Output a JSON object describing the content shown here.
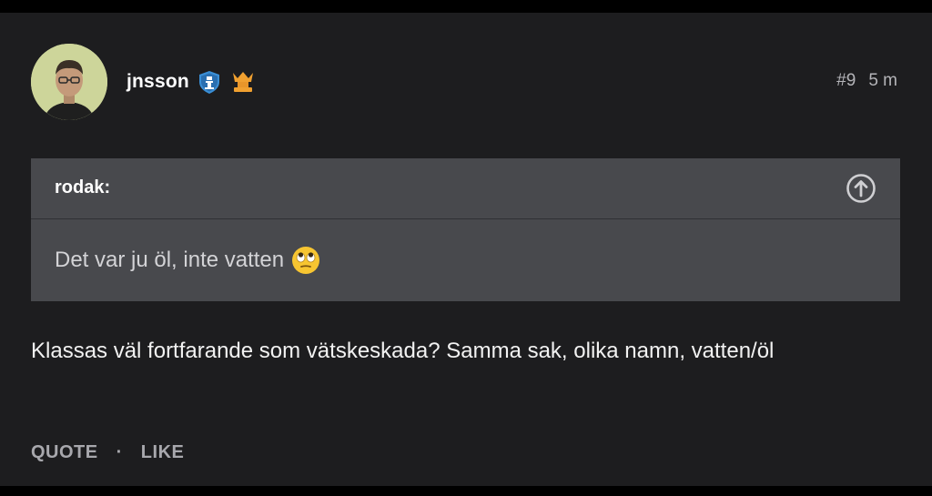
{
  "post": {
    "author": "jnsson",
    "badges": [
      "shield-badge-icon",
      "crown-badge-icon"
    ],
    "number": "#9",
    "time": "5 m"
  },
  "quote": {
    "author": "rodak:",
    "text": "Det var ju öl, inte vatten",
    "emoji": "rolling-eyes-emoji"
  },
  "body": {
    "text": "Klassas väl fortfarande som vätskeskada? Samma sak, olika namn, vatten/öl"
  },
  "actions": {
    "quote_label": "QUOTE",
    "separator": "·",
    "like_label": "LIKE"
  },
  "colors": {
    "background": "#1d1d1f",
    "quote_background": "#48494d",
    "shield_badge": "#3a8fd6",
    "crown_badge": "#f0a030"
  }
}
